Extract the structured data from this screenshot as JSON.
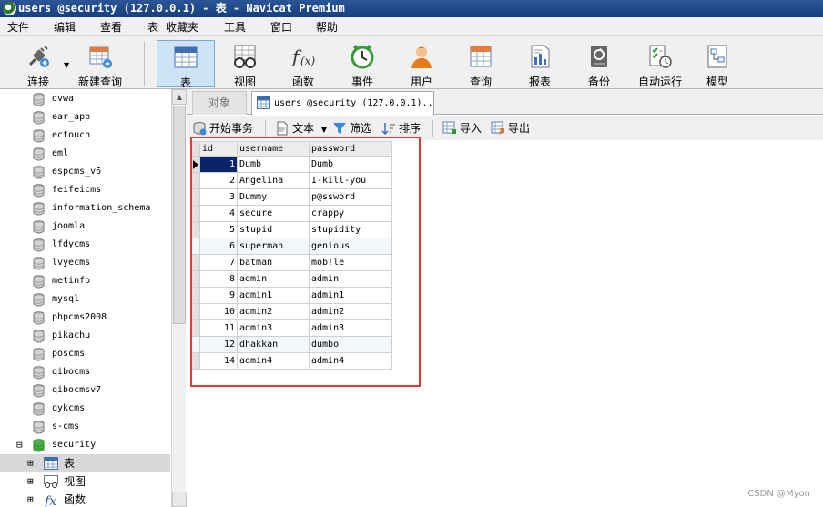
{
  "window": {
    "title": "users @security (127.0.0.1) - 表 - Navicat Premium"
  },
  "menu": [
    "文件",
    "编辑",
    "查看",
    "表",
    "收藏夹",
    "工具",
    "窗口",
    "帮助"
  ],
  "toolbar": {
    "connect": "连接",
    "new_query": "新建查询",
    "items": [
      "表",
      "视图",
      "函数",
      "事件",
      "用户",
      "查询",
      "报表",
      "备份",
      "自动运行",
      "模型"
    ]
  },
  "sidebar": {
    "databases": [
      "dvwa",
      "ear_app",
      "ectouch",
      "eml",
      "espcms_v6",
      "feifeicms",
      "information_schema",
      "joomla",
      "lfdycms",
      "lvyecms",
      "metinfo",
      "mysql",
      "phpcms2008",
      "pikachu",
      "poscms",
      "qibocms",
      "qibocmsv7",
      "qykcms",
      "s-cms",
      "security"
    ],
    "security_children": [
      "表",
      "视图",
      "函数"
    ],
    "expand_minus": "⊟",
    "expand_plus": "⊞"
  },
  "tabs": {
    "objects": "对象",
    "data": "users @security (127.0.0.1)..."
  },
  "subtoolbar": {
    "begin_transaction": "开始事务",
    "text": "文本",
    "filter": "筛选",
    "sort": "排序",
    "import": "导入",
    "export": "导出"
  },
  "table": {
    "columns": [
      "id",
      "username",
      "password"
    ],
    "rows": [
      [
        "1",
        "Dumb",
        "Dumb"
      ],
      [
        "2",
        "Angelina",
        "I-kill-you"
      ],
      [
        "3",
        "Dummy",
        "p@ssword"
      ],
      [
        "4",
        "secure",
        "crappy"
      ],
      [
        "5",
        "stupid",
        "stupidity"
      ],
      [
        "6",
        "superman",
        "genious"
      ],
      [
        "7",
        "batman",
        "mob!le"
      ],
      [
        "8",
        "admin",
        "admin"
      ],
      [
        "9",
        "admin1",
        "admin1"
      ],
      [
        "10",
        "admin2",
        "admin2"
      ],
      [
        "11",
        "admin3",
        "admin3"
      ],
      [
        "12",
        "dhakkan",
        "dumbo"
      ],
      [
        "14",
        "admin4",
        "admin4"
      ]
    ]
  },
  "watermark": "CSDN @Myon⁠",
  "colors": {
    "title_bar": "#1f4a8a",
    "highlight_box": "#e53a3a",
    "selected_cell": "#0a246a"
  }
}
